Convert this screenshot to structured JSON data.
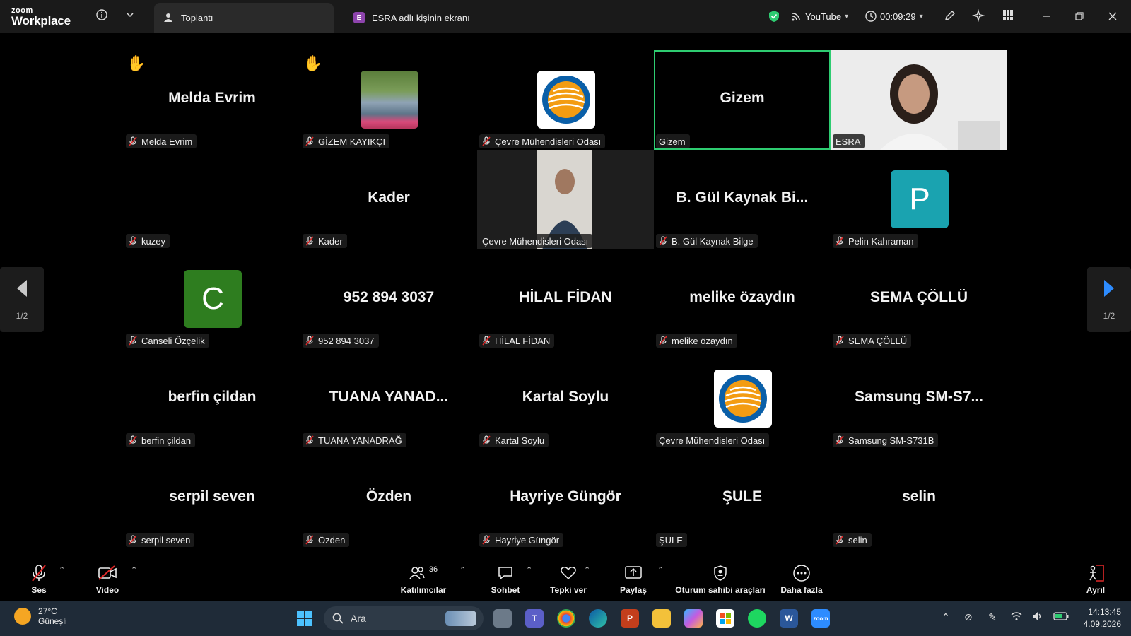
{
  "app": {
    "logo_top": "zoom",
    "logo_bottom": "Workplace"
  },
  "tabs": [
    {
      "label": "Toplantı",
      "active": true
    },
    {
      "label": "ESRA adlı kişinin ekranı",
      "badge": "E",
      "active": false
    }
  ],
  "titlebar": {
    "stream_label": "YouTube",
    "timer": "00:09:29"
  },
  "participants": [
    {
      "display": "Melda Evrim",
      "label": "Melda Evrim",
      "muted": true,
      "hand": true,
      "type": "name"
    },
    {
      "display": "",
      "label": "GİZEM KAYIKÇI",
      "muted": true,
      "hand": true,
      "type": "photo"
    },
    {
      "display": "",
      "label": "Çevre Mühendisleri Odası",
      "muted": true,
      "type": "org-logo"
    },
    {
      "display": "Gizem",
      "label": "Gizem",
      "muted": false,
      "type": "name",
      "active_speaker": true
    },
    {
      "display": "",
      "label": "ESRA",
      "muted": false,
      "type": "video-woman"
    },
    {
      "display": "",
      "label": "kuzey",
      "muted": true,
      "type": "black"
    },
    {
      "display": "Kader",
      "label": "Kader",
      "muted": true,
      "type": "name"
    },
    {
      "display": "",
      "label": "Çevre Mühendisleri Odası",
      "muted": false,
      "type": "video-man"
    },
    {
      "display": "B. Gül Kaynak Bi...",
      "label": "B. Gül Kaynak Bilge",
      "muted": true,
      "type": "name"
    },
    {
      "display": "P",
      "label": "Pelin Kahraman",
      "muted": true,
      "type": "avatar",
      "color": "#1aa3b0"
    },
    {
      "display": "C",
      "label": "Canseli Özçelik",
      "muted": true,
      "type": "avatar",
      "color": "#2e7d1f"
    },
    {
      "display": "952 894 3037",
      "label": "952 894 3037",
      "muted": true,
      "type": "name"
    },
    {
      "display": "HİLAL FİDAN",
      "label": "HİLAL FİDAN",
      "muted": true,
      "type": "name"
    },
    {
      "display": "melike özaydın",
      "label": "melike özaydın",
      "muted": true,
      "type": "name"
    },
    {
      "display": "SEMA ÇÖLLÜ",
      "label": "SEMA ÇÖLLÜ",
      "muted": true,
      "type": "name"
    },
    {
      "display": "berfin çildan",
      "label": "berfin çildan",
      "muted": true,
      "type": "name"
    },
    {
      "display": "TUANA  YANAD...",
      "label": "TUANA YANADRAĞ",
      "muted": true,
      "type": "name"
    },
    {
      "display": "Kartal Soylu",
      "label": "Kartal Soylu",
      "muted": true,
      "type": "name"
    },
    {
      "display": "",
      "label": "Çevre Mühendisleri Odası",
      "muted": false,
      "type": "org-logo"
    },
    {
      "display": "Samsung  SM-S7...",
      "label": "Samsung SM-S731B",
      "muted": true,
      "type": "name"
    },
    {
      "display": "serpil seven",
      "label": "serpil seven",
      "muted": true,
      "type": "name"
    },
    {
      "display": "Özden",
      "label": "Özden",
      "muted": true,
      "type": "name"
    },
    {
      "display": "Hayriye Güngör",
      "label": "Hayriye Güngör",
      "muted": true,
      "type": "name"
    },
    {
      "display": "ŞULE",
      "label": "ŞULE",
      "muted": false,
      "type": "name"
    },
    {
      "display": "selin",
      "label": "selin",
      "muted": true,
      "type": "name"
    }
  ],
  "pager": {
    "left": "1/2",
    "right": "1/2"
  },
  "toolbar": {
    "audio": "Ses",
    "video": "Video",
    "participants": "Katılımcılar",
    "participants_count": "36",
    "chat": "Sohbet",
    "react": "Tepki ver",
    "share": "Paylaş",
    "host_tools": "Oturum sahibi araçları",
    "more": "Daha fazla",
    "leave": "Ayrıl"
  },
  "taskbar": {
    "temp": "27°C",
    "weather": "Güneşli",
    "search_placeholder": "Ara",
    "time": "14:13:45",
    "date": "4.09.2026"
  }
}
